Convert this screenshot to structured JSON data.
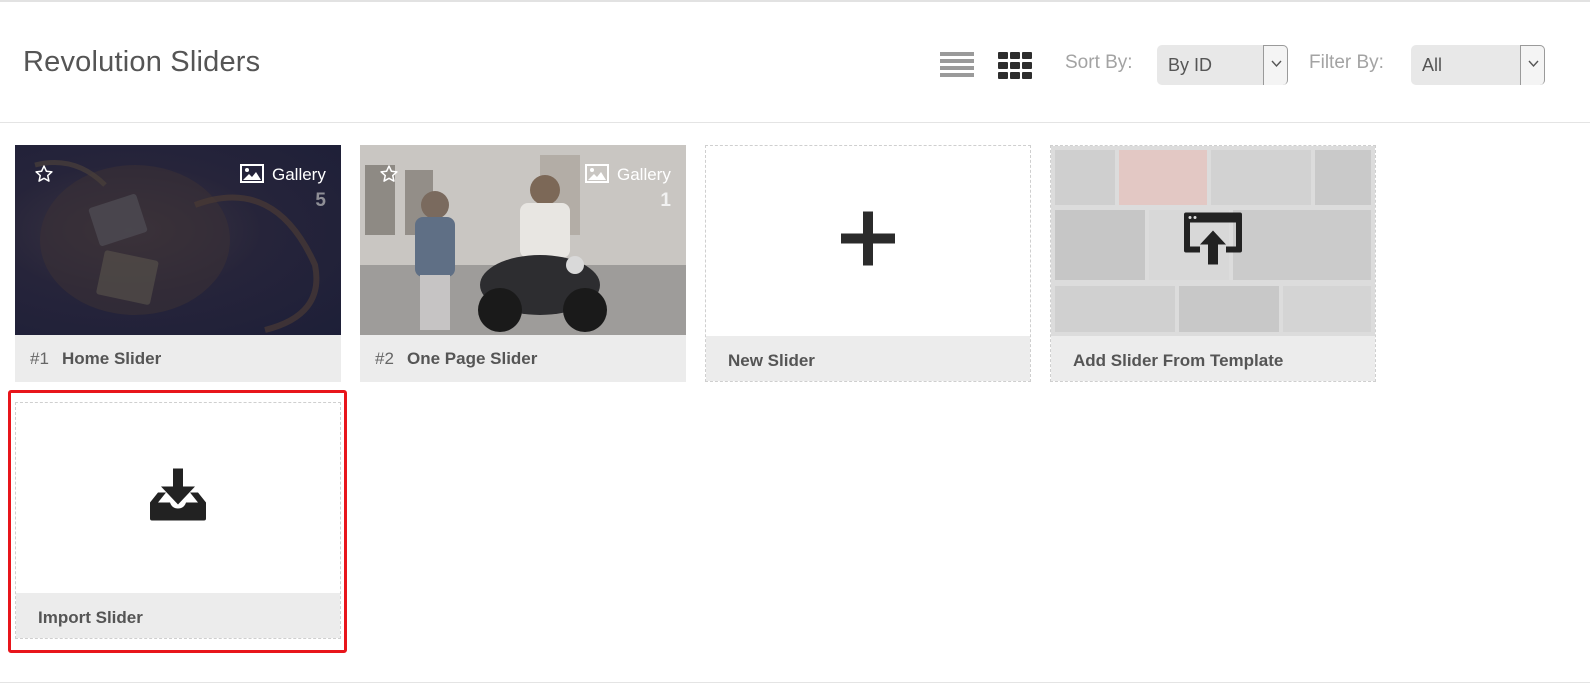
{
  "header": {
    "title": "Revolution Sliders",
    "view_list_icon": "list-view-icon",
    "view_grid_icon": "grid-view-icon",
    "sort": {
      "label": "Sort By:",
      "value": "By ID"
    },
    "filter": {
      "label": "Filter By:",
      "value": "All"
    }
  },
  "sliders": [
    {
      "number": "#1",
      "name": "Home Slider",
      "type_label": "Gallery",
      "count": "5",
      "icon": "gallery-icon"
    },
    {
      "number": "#2",
      "name": "One Page Slider",
      "type_label": "Gallery",
      "count": "1",
      "icon": "gallery-icon"
    }
  ],
  "actions": {
    "new_slider": {
      "label": "New Slider",
      "icon": "plus-icon"
    },
    "add_from_template": {
      "label": "Add Slider From Template",
      "icon": "template-upload-icon"
    },
    "import_slider": {
      "label": "Import Slider",
      "icon": "download-tray-icon"
    }
  },
  "colors": {
    "highlight": "#e8151b",
    "card_footer": "#ececec",
    "select_bg": "#e8e8e8"
  }
}
